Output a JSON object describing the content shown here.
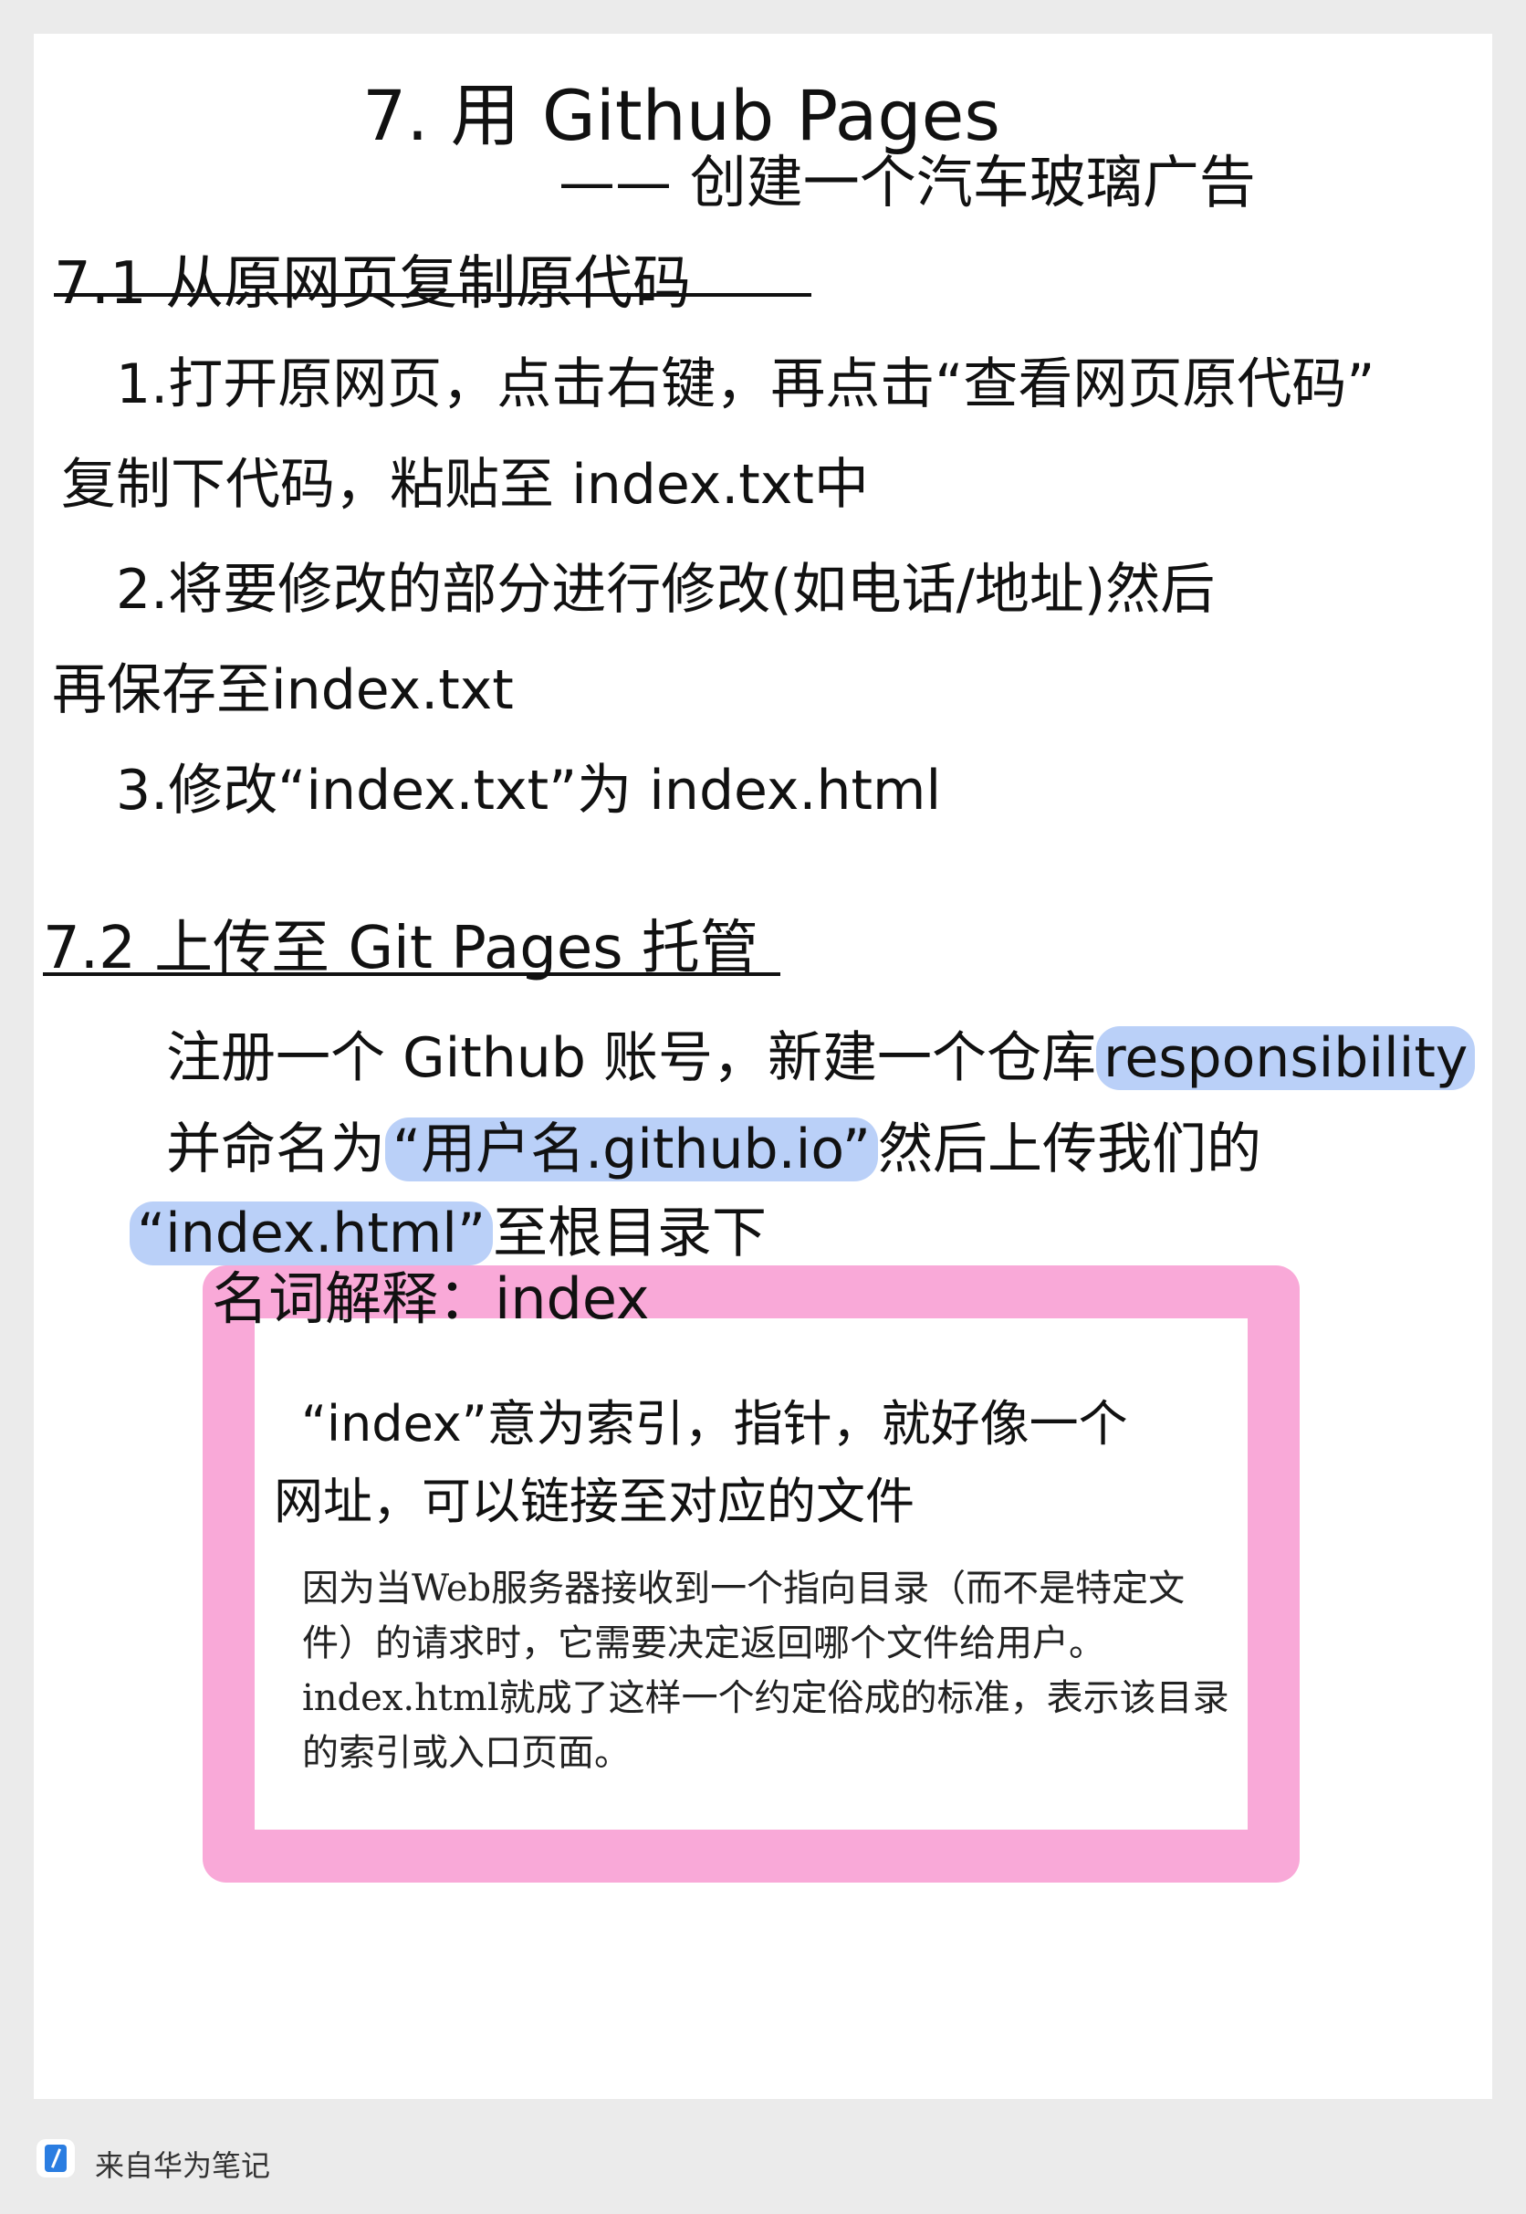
{
  "title": "7. 用 Github  Pages",
  "subtitle": "—— 创建一个汽车玻璃广告",
  "section1": {
    "heading": "7.1  从原网页复制原代码",
    "line1": "1.打开原网页，点击右键，再点击“查看网页原代码”",
    "line2": "复制下代码，粘贴至  index.txt中",
    "line3": "2.将要修改的部分进行修改(如电话/地址)然后",
    "line4": "再保存至index.txt",
    "line5": "3.修改“index.txt”为  index.html"
  },
  "section2": {
    "heading": "7.2  上传至 Git Pages 托管",
    "line1_prefix": "注册一个 Github 账号，新建一个仓库",
    "line1_highlight": "responsibility",
    "line2_prefix": "并命名为",
    "line2_highlight": "“用户名.github.io”",
    "line2_suffix": "然后上传我们的",
    "line3_highlight": "“index.html”",
    "line3_suffix": "至根目录下"
  },
  "glossary": {
    "title": "名词解释：index",
    "def_line1": "“index”意为索引，指针，就好像一个",
    "def_line2": "网址，可以链接至对应的文件",
    "paragraph": "因为当Web服务器接收到一个指向目录（而不是特定文件）的请求时，它需要决定返回哪个文件给用户。index.html就成了这样一个约定俗成的标准，表示该目录的索引或入口页面。"
  },
  "footer": {
    "icon": "huawei-notes-icon",
    "text": "来自华为笔记"
  },
  "colors": {
    "highlight": "#a0bef5",
    "box_border": "#f9a9d8",
    "page": "#ffffff",
    "background": "#ebebeb",
    "app_icon": "#2a7de1"
  }
}
